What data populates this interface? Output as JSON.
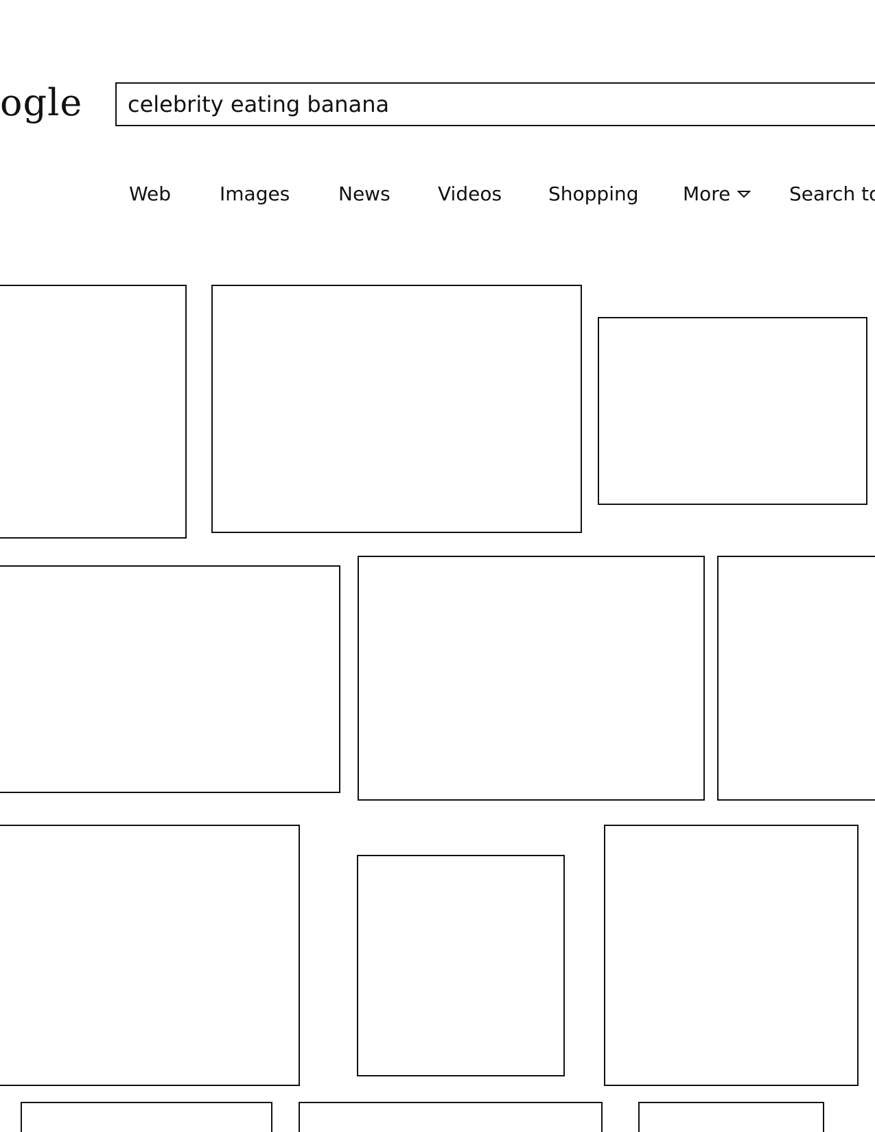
{
  "logo": {
    "text": "ogle"
  },
  "search": {
    "query": "celebrity eating banana"
  },
  "tabs": [
    {
      "label": "Web"
    },
    {
      "label": "Images"
    },
    {
      "label": "News"
    },
    {
      "label": "Videos"
    },
    {
      "label": "Shopping"
    },
    {
      "label": "More"
    },
    {
      "label": "Search to"
    }
  ],
  "icons": {
    "more": "chevron-down-icon"
  }
}
